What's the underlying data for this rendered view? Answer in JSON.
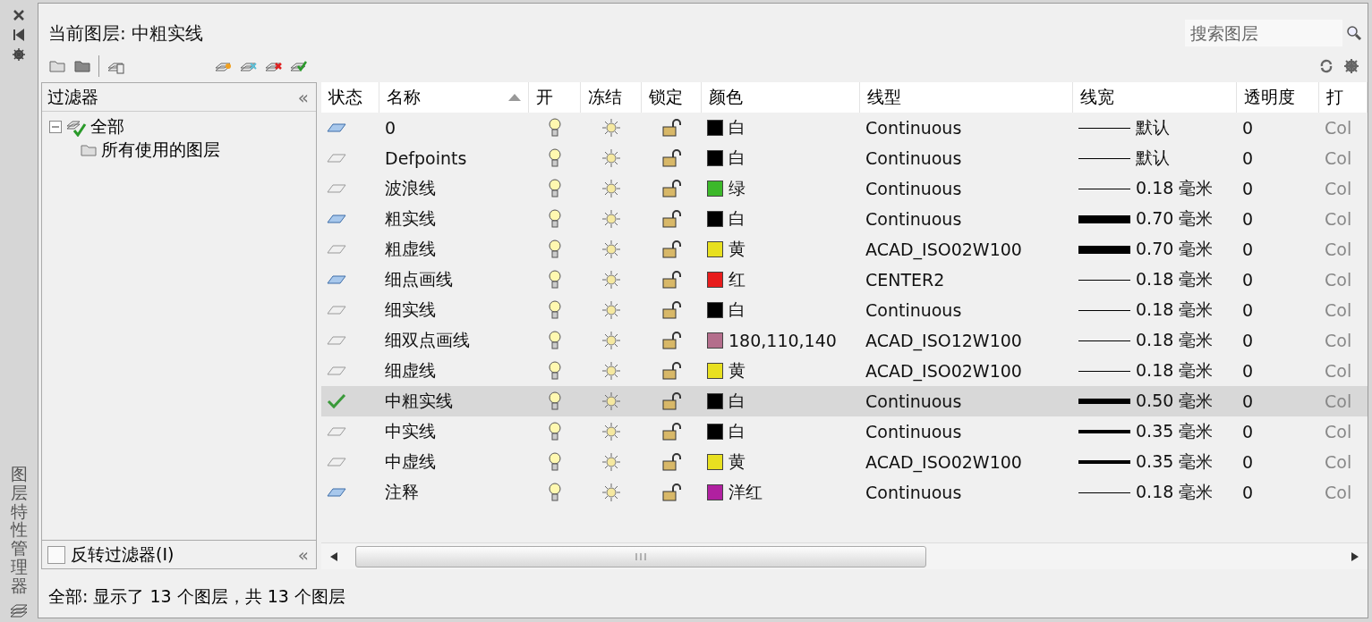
{
  "side_strip": {
    "title": "图层特性管理器"
  },
  "header": {
    "current_layer": "当前图层: 中粗实线",
    "search": {
      "placeholder": "搜索图层"
    }
  },
  "filters": {
    "title": "过滤器",
    "collapse": "«",
    "tree": [
      {
        "label": "全部",
        "expanded": true,
        "children": [
          {
            "label": "所有使用的图层"
          }
        ]
      }
    ],
    "invert": {
      "label": "反转过滤器(I)",
      "checked": false,
      "collapse": "«"
    }
  },
  "table": {
    "columns": [
      "状态",
      "名称",
      "开",
      "冻结",
      "锁定",
      "颜色",
      "线型",
      "线宽",
      "透明度",
      "打"
    ],
    "rows": [
      {
        "kind": "used",
        "name": "0",
        "on": true,
        "frozen": false,
        "locked": false,
        "color": "#000000",
        "color_name": "白",
        "linetype": "Continuous",
        "lineweight": {
          "kind": "thin",
          "text": "默认"
        },
        "transparency": "0",
        "plot": "Col",
        "selected": false
      },
      {
        "kind": "unused",
        "name": "Defpoints",
        "on": true,
        "frozen": false,
        "locked": false,
        "color": "#000000",
        "color_name": "白",
        "linetype": "Continuous",
        "lineweight": {
          "kind": "thin",
          "text": "默认"
        },
        "transparency": "0",
        "plot": "Col",
        "selected": false
      },
      {
        "kind": "unused",
        "name": "波浪线",
        "on": true,
        "frozen": false,
        "locked": false,
        "color": "#3cb82a",
        "color_name": "绿",
        "linetype": "Continuous",
        "lineweight": {
          "kind": "thin",
          "text": "0.18 毫米"
        },
        "transparency": "0",
        "plot": "Col",
        "selected": false
      },
      {
        "kind": "used",
        "name": "粗实线",
        "on": true,
        "frozen": false,
        "locked": false,
        "color": "#000000",
        "color_name": "白",
        "linetype": "Continuous",
        "lineweight": {
          "kind": "heavy",
          "text": "0.70 毫米"
        },
        "transparency": "0",
        "plot": "Col",
        "selected": false
      },
      {
        "kind": "unused",
        "name": "粗虚线",
        "on": true,
        "frozen": false,
        "locked": false,
        "color": "#e8e020",
        "color_name": "黄",
        "linetype": "ACAD_ISO02W100",
        "lineweight": {
          "kind": "heavy",
          "text": "0.70 毫米"
        },
        "transparency": "0",
        "plot": "Col",
        "selected": false
      },
      {
        "kind": "used",
        "name": "细点画线",
        "on": true,
        "frozen": false,
        "locked": false,
        "color": "#e81c1c",
        "color_name": "红",
        "linetype": "CENTER2",
        "lineweight": {
          "kind": "thin",
          "text": "0.18 毫米"
        },
        "transparency": "0",
        "plot": "Col",
        "selected": false
      },
      {
        "kind": "unused",
        "name": "细实线",
        "on": true,
        "frozen": false,
        "locked": false,
        "color": "#000000",
        "color_name": "白",
        "linetype": "Continuous",
        "lineweight": {
          "kind": "thin",
          "text": "0.18 毫米"
        },
        "transparency": "0",
        "plot": "Col",
        "selected": false
      },
      {
        "kind": "unused",
        "name": "细双点画线",
        "on": true,
        "frozen": false,
        "locked": false,
        "color": "#b46e8c",
        "color_name": "180,110,140",
        "linetype": "ACAD_ISO12W100",
        "lineweight": {
          "kind": "thin",
          "text": "0.18 毫米"
        },
        "transparency": "0",
        "plot": "Col",
        "selected": false
      },
      {
        "kind": "unused",
        "name": "细虚线",
        "on": true,
        "frozen": false,
        "locked": false,
        "color": "#e8e020",
        "color_name": "黄",
        "linetype": "ACAD_ISO02W100",
        "lineweight": {
          "kind": "thin",
          "text": "0.18 毫米"
        },
        "transparency": "0",
        "plot": "Col",
        "selected": false
      },
      {
        "kind": "current",
        "name": "中粗实线",
        "on": true,
        "frozen": false,
        "locked": false,
        "color": "#000000",
        "color_name": "白",
        "linetype": "Continuous",
        "lineweight": {
          "kind": "bold",
          "text": "0.50 毫米"
        },
        "transparency": "0",
        "plot": "Col",
        "selected": true
      },
      {
        "kind": "unused",
        "name": "中实线",
        "on": true,
        "frozen": false,
        "locked": false,
        "color": "#000000",
        "color_name": "白",
        "linetype": "Continuous",
        "lineweight": {
          "kind": "medium",
          "text": "0.35 毫米"
        },
        "transparency": "0",
        "plot": "Col",
        "selected": false
      },
      {
        "kind": "unused",
        "name": "中虚线",
        "on": true,
        "frozen": false,
        "locked": false,
        "color": "#e8e020",
        "color_name": "黄",
        "linetype": "ACAD_ISO02W100",
        "lineweight": {
          "kind": "medium",
          "text": "0.35 毫米"
        },
        "transparency": "0",
        "plot": "Col",
        "selected": false
      },
      {
        "kind": "used",
        "name": "注释",
        "on": true,
        "frozen": false,
        "locked": false,
        "color": "#b020a0",
        "color_name": "洋红",
        "linetype": "Continuous",
        "lineweight": {
          "kind": "thin",
          "text": "0.18 毫米"
        },
        "transparency": "0",
        "plot": "Col",
        "selected": false
      }
    ]
  },
  "status_bar": "全部: 显示了 13 个图层，共 13 个图层"
}
